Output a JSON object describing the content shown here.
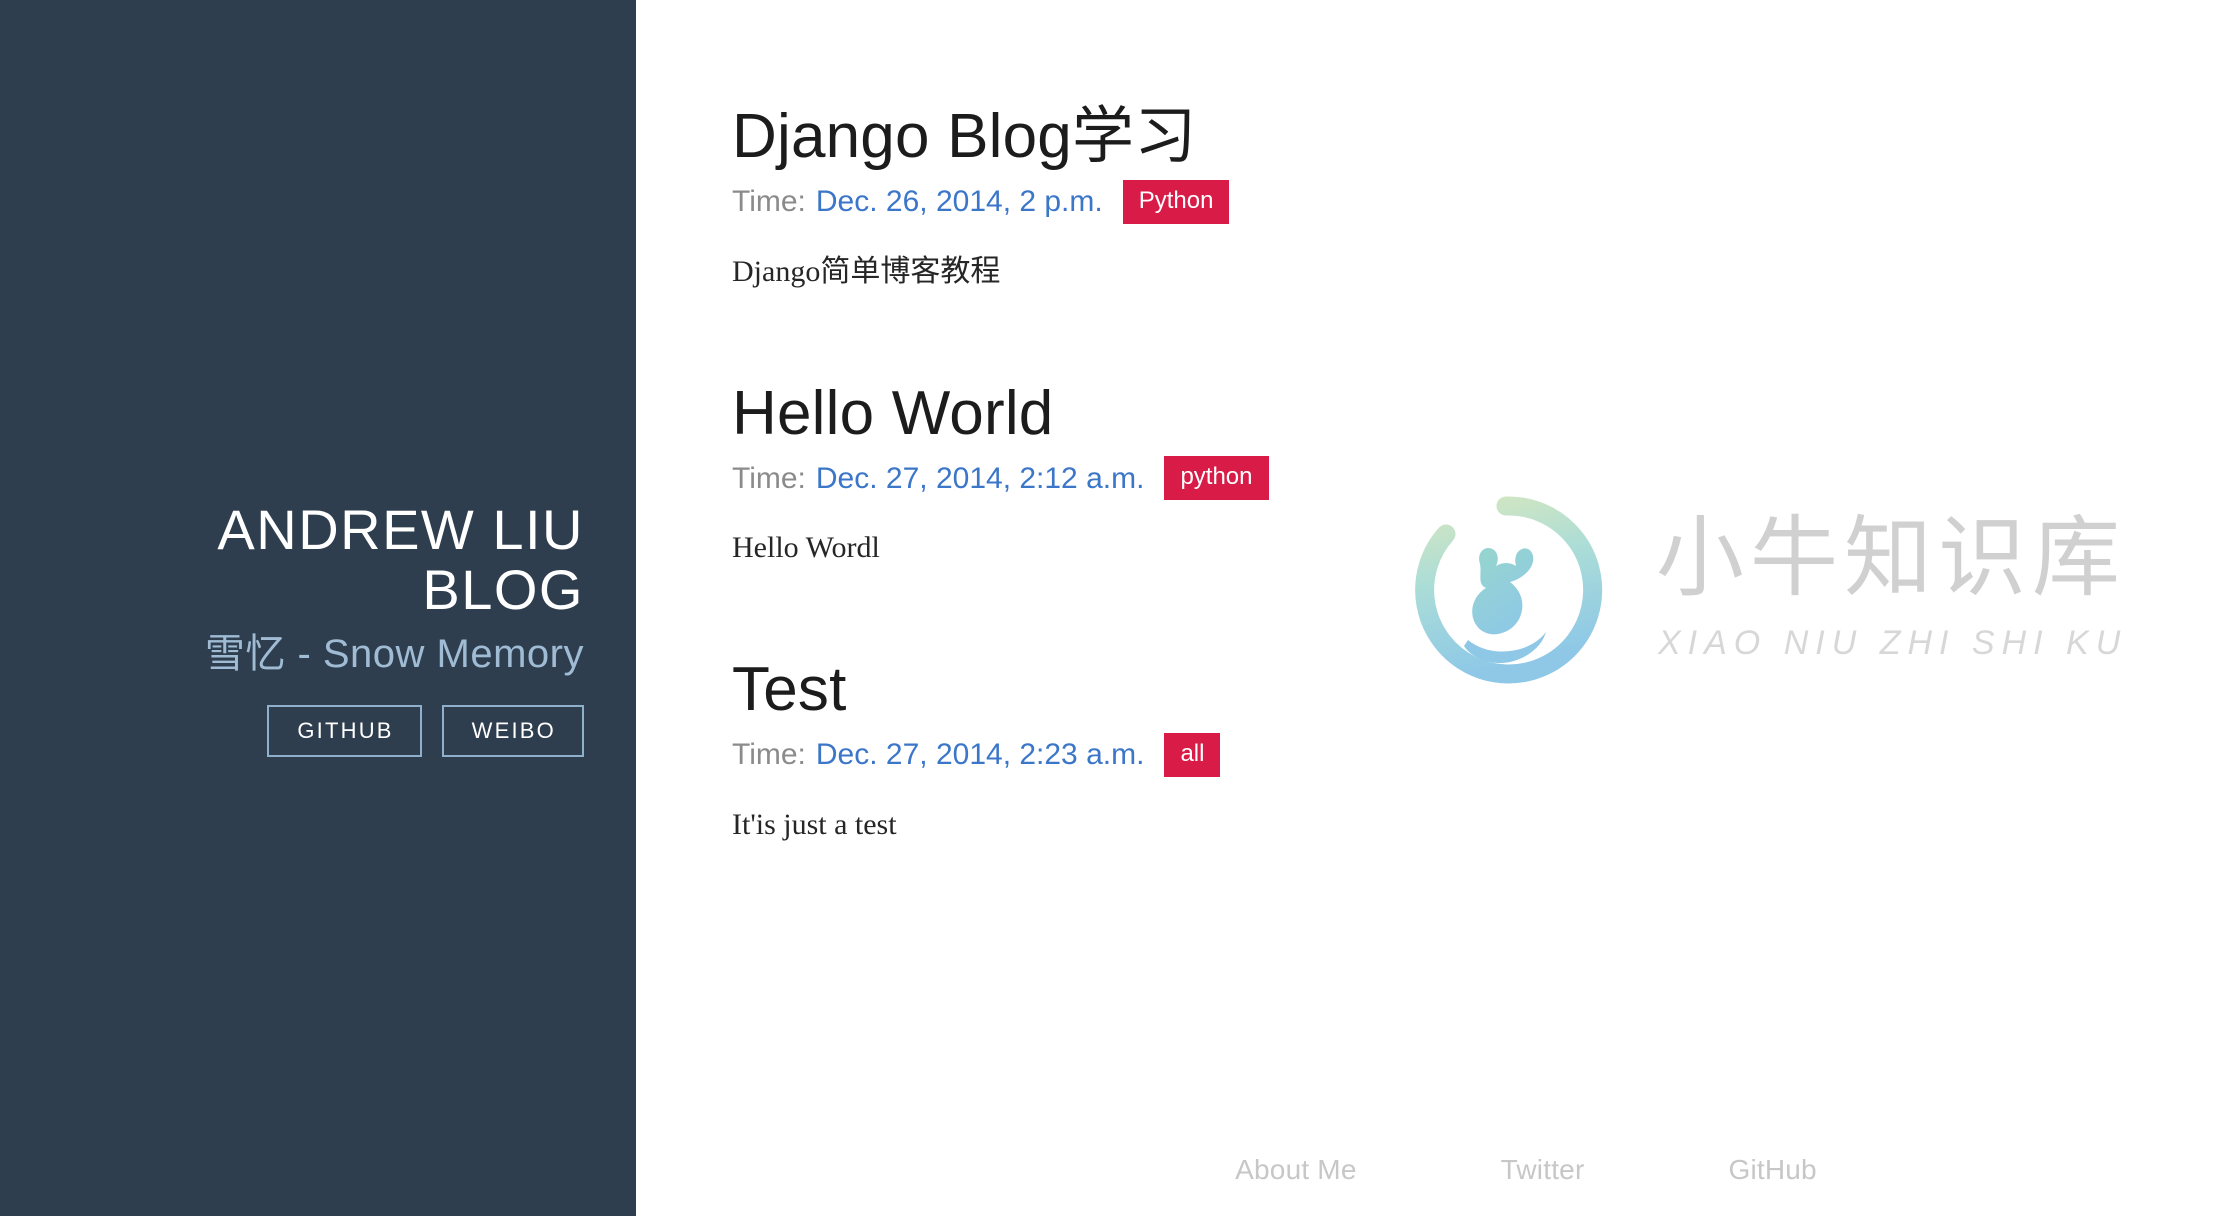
{
  "sidebar": {
    "site_title": "ANDREW LIU\nBLOG",
    "site_subtitle": "雪忆 - Snow Memory",
    "links": [
      {
        "label": "GITHUB",
        "name": "github"
      },
      {
        "label": "WEIBO",
        "name": "weibo"
      }
    ]
  },
  "posts": [
    {
      "title": "Django Blog学习",
      "time_label": "Time:",
      "date": "Dec. 26, 2014, 2 p.m.",
      "tag": "Python",
      "summary": "Django简单博客教程"
    },
    {
      "title": "Hello World",
      "time_label": "Time:",
      "date": "Dec. 27, 2014, 2:12 a.m.",
      "tag": "python",
      "summary": "Hello Wordl"
    },
    {
      "title": "Test",
      "time_label": "Time:",
      "date": "Dec. 27, 2014, 2:23 a.m.",
      "tag": "all",
      "summary": "It'is just a test"
    }
  ],
  "footer": {
    "links": [
      {
        "label": "About Me",
        "name": "about-me"
      },
      {
        "label": "Twitter",
        "name": "twitter"
      },
      {
        "label": "GitHub",
        "name": "github"
      }
    ]
  },
  "watermark": {
    "chinese": "小牛知识库",
    "pinyin": "XIAO NIU ZHI SHI KU"
  },
  "colors": {
    "sidebar_bg": "#2f3e4e",
    "sidebar_accent": "#9fbcd4",
    "tag_bg": "#d81b47",
    "link_blue": "#3b76c9",
    "meta_gray": "#8b8b8b",
    "footer_gray": "#c7c7c7",
    "title_black": "#1c1c1c"
  }
}
